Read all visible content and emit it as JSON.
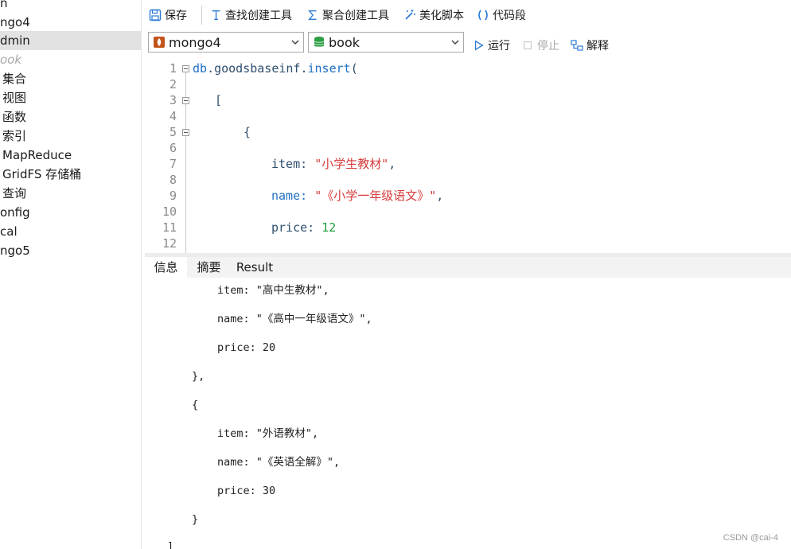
{
  "sidebar": {
    "items": [
      {
        "label": "n"
      },
      {
        "label": "ngo4"
      },
      {
        "label": "dmin"
      },
      {
        "label": "ook"
      },
      {
        "label": "集合"
      },
      {
        "label": "视图"
      },
      {
        "label": "函数"
      },
      {
        "label": "索引"
      },
      {
        "label": "MapReduce"
      },
      {
        "label": "GridFS 存储桶"
      },
      {
        "label": "查询"
      },
      {
        "label": "onfig"
      },
      {
        "label": "cal"
      },
      {
        "label": "ngo5"
      }
    ]
  },
  "toolbar": {
    "save": "保存",
    "find_builder": "查找创建工具",
    "aggregate_builder": "聚合创建工具",
    "beautify": "美化脚本",
    "snippet": "代码段",
    "connection": "mongo4",
    "database": "book",
    "run": "运行",
    "stop": "停止",
    "explain": "解释"
  },
  "editor": {
    "line_numbers": [
      "1",
      "2",
      "3",
      "4",
      "5",
      "6",
      "7",
      "8",
      "9",
      "10",
      "11",
      "12"
    ],
    "line1": {
      "obj": "db",
      "dot1": ".",
      "coll": "goodsbaseinf",
      "dot2": ".",
      "method": "insert",
      "paren": "("
    },
    "line3": "[",
    "line5": "{",
    "line7": {
      "key": "item: ",
      "value": "\"小学生教材\"",
      "comma": ","
    },
    "line9": {
      "key": "name: ",
      "value": "\"《小学一年级语文》\"",
      "comma": ","
    },
    "line11": {
      "key": "price: ",
      "value": "12"
    }
  },
  "tabs": {
    "info": "信息",
    "summary": "摘要",
    "result": "Result"
  },
  "output": {
    "lines": [
      "item: \"高中生教材\",",
      "name: \"《高中一年级语文》\",",
      "price: 20",
      "},",
      "{",
      "item: \"外语教材\",",
      "name: \"《英语全解》\",",
      "price: 30",
      "}",
      "]"
    ]
  },
  "watermark": "CSDN @cai-4",
  "colors": {
    "selected_row": "#e2e2e2",
    "keyword_blue": "#1f6fc5",
    "string_red": "#d63a3a",
    "number_green": "#1e9e3a",
    "accent_icon": "#2a7ad5"
  }
}
